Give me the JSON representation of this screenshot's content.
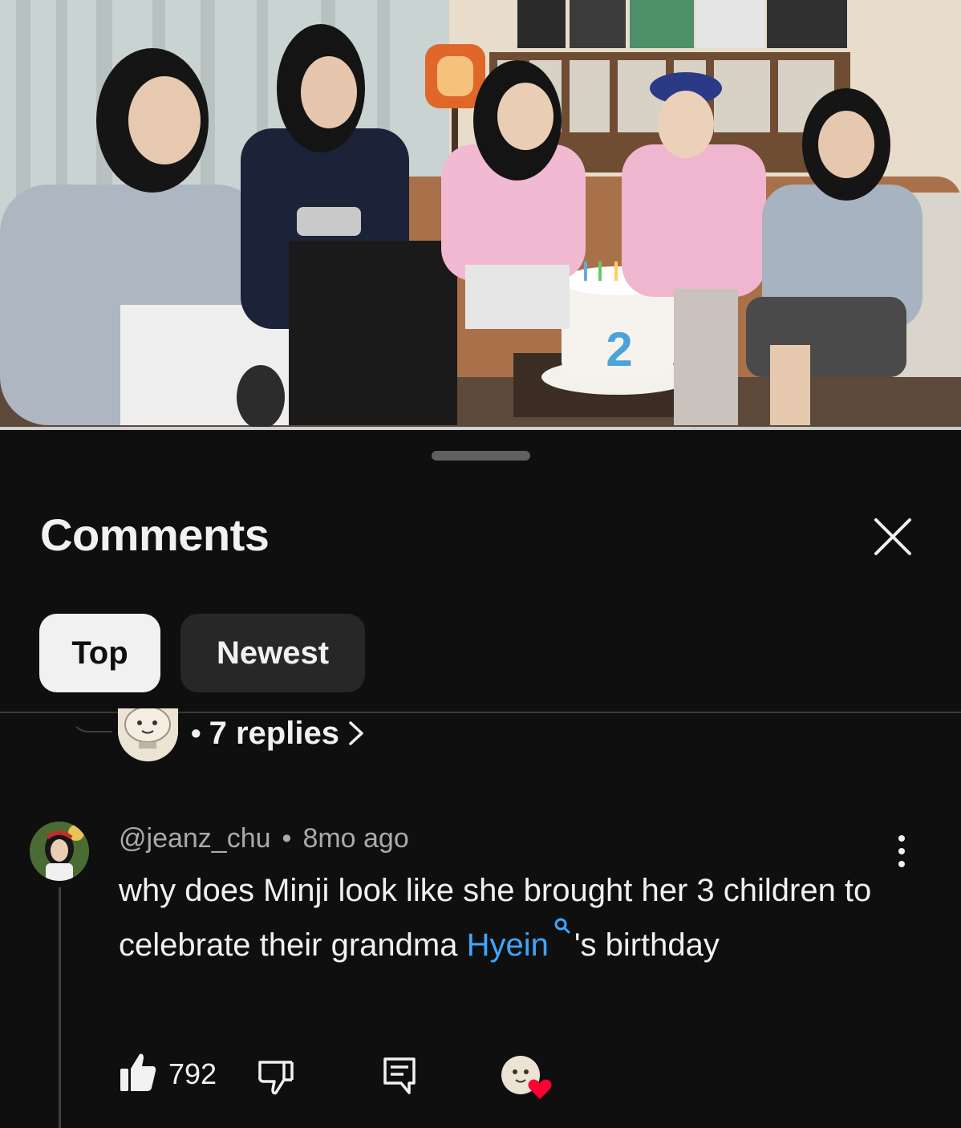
{
  "video": {
    "description_label": "video-frame"
  },
  "comments_panel": {
    "title": "Comments",
    "close_icon": "close-icon",
    "filters": [
      {
        "label": "Top",
        "selected": true
      },
      {
        "label": "Newest",
        "selected": false
      }
    ]
  },
  "previous_thread": {
    "replies_label": "7 replies",
    "separator": "•"
  },
  "comment": {
    "handle": "@jeanz_chu",
    "separator": "•",
    "time": "8mo ago",
    "text_before": "why does Minji look like she brought her 3 children to celebrate their grandma ",
    "mention": "Hyein",
    "text_after": "'s birthday",
    "likes": "792"
  },
  "colors": {
    "background": "#0f0f0f",
    "chip_selected": "#f1f1f1",
    "chip": "#272727",
    "link": "#3ea6ff",
    "secondary_text": "#aaaaaa",
    "heart": "#ff0033"
  }
}
